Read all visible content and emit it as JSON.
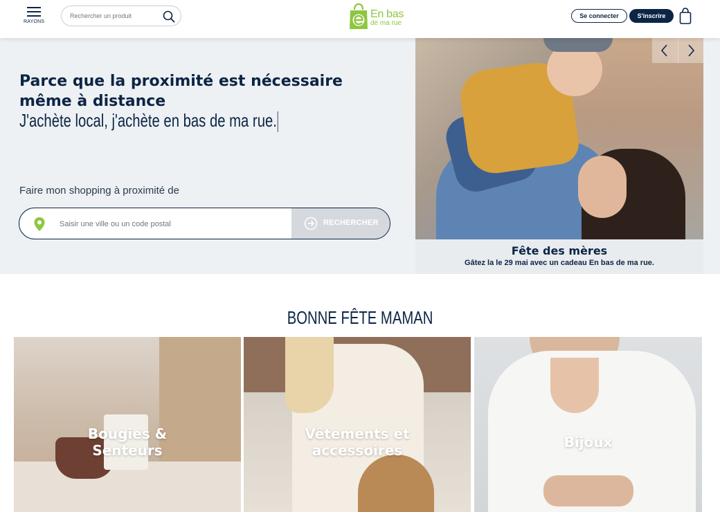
{
  "header": {
    "menu_label": "RAYONS",
    "search_placeholder": "Rechercher un produit",
    "logo_line1": "En bas",
    "logo_line2": "de ma rue",
    "login_label": "Se connecter",
    "signup_label": "S'inscrire"
  },
  "hero": {
    "title": "Parce que la proximité est nécessaire même à distance",
    "subtitle": "J'achète local, j'achète en bas de ma rue.",
    "shop_label": "Faire mon shopping à proximité de",
    "location_placeholder": "Saisir une ville ou un code postal",
    "search_button_label": "RECHERCHER"
  },
  "slide": {
    "title": "Fête des mères",
    "text_prefix": "Gâtez la le 29 mai avec un cadeau",
    "text_brand": "En bas de ma rue."
  },
  "section": {
    "title": "BONNE FÊTE MAMAN",
    "cards": [
      {
        "line1": "Bougies &",
        "line2": "Senteurs"
      },
      {
        "line1": "Vêtements et",
        "line2": "accessoires"
      },
      {
        "line1": "Bijoux",
        "line2": ""
      }
    ]
  },
  "colors": {
    "brand_navy": "#0c2545",
    "brand_green": "#8ec63f",
    "hero_bg": "#eef1f4",
    "search_button_bg": "#d5d9de"
  },
  "icons": [
    "menu-icon",
    "search-icon",
    "shopping-bag-icon",
    "location-pin-icon",
    "arrow-circle-icon",
    "chevron-left-icon",
    "chevron-right-icon"
  ]
}
